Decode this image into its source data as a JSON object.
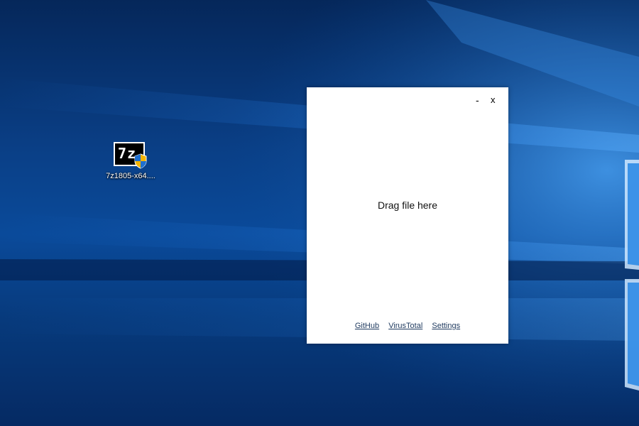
{
  "desktop": {
    "icons": [
      {
        "label": "7z1805-x64....",
        "icon": "7zip-installer-icon"
      }
    ]
  },
  "app_window": {
    "minimize_label": "-",
    "close_label": "x",
    "drop_prompt": "Drag file here",
    "links": [
      {
        "label": "GitHub"
      },
      {
        "label": "VirusTotal"
      },
      {
        "label": "Settings"
      }
    ]
  },
  "colors": {
    "desktop_bg": "#0a4a9a",
    "window_bg": "#ffffff",
    "link_color": "#1f3a5f"
  }
}
